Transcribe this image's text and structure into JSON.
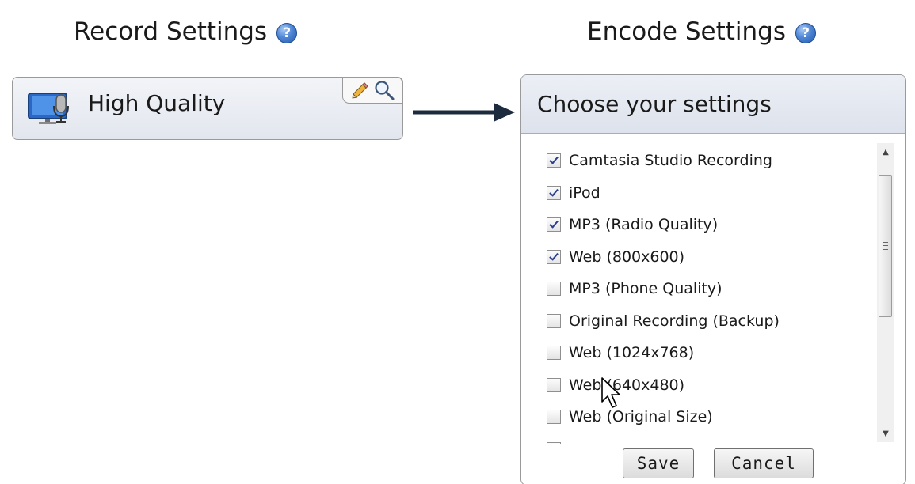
{
  "record_settings": {
    "title": "Record Settings",
    "help_icon": "help-icon",
    "preset_name": "High Quality",
    "preset_icon": "screen-microphone-icon",
    "tools": [
      "edit-pencil-icon",
      "preview-magnifier-icon"
    ]
  },
  "encode_settings": {
    "title": "Encode Settings",
    "help_icon": "help-icon",
    "panel_title": "Choose your settings",
    "items": [
      {
        "label": "Camtasia Studio Recording",
        "checked": true
      },
      {
        "label": "iPod",
        "checked": true
      },
      {
        "label": "MP3 (Radio Quality)",
        "checked": true
      },
      {
        "label": "Web (800x600)",
        "checked": true
      },
      {
        "label": "MP3 (Phone Quality)",
        "checked": false
      },
      {
        "label": "Original Recording (Backup)",
        "checked": false
      },
      {
        "label": "Web (1024x768)",
        "checked": false
      },
      {
        "label": "Web (640x480)",
        "checked": false
      },
      {
        "label": "Web (Original Size)",
        "checked": false
      },
      {
        "label": "",
        "checked": false
      }
    ],
    "save_label": "Save",
    "cancel_label": "Cancel"
  },
  "colors": {
    "help_blue": "#3a74c8",
    "arrow": "#1d2b3f",
    "checkmark": "#2a3f8f",
    "panel_header": "#e3e7ef"
  }
}
